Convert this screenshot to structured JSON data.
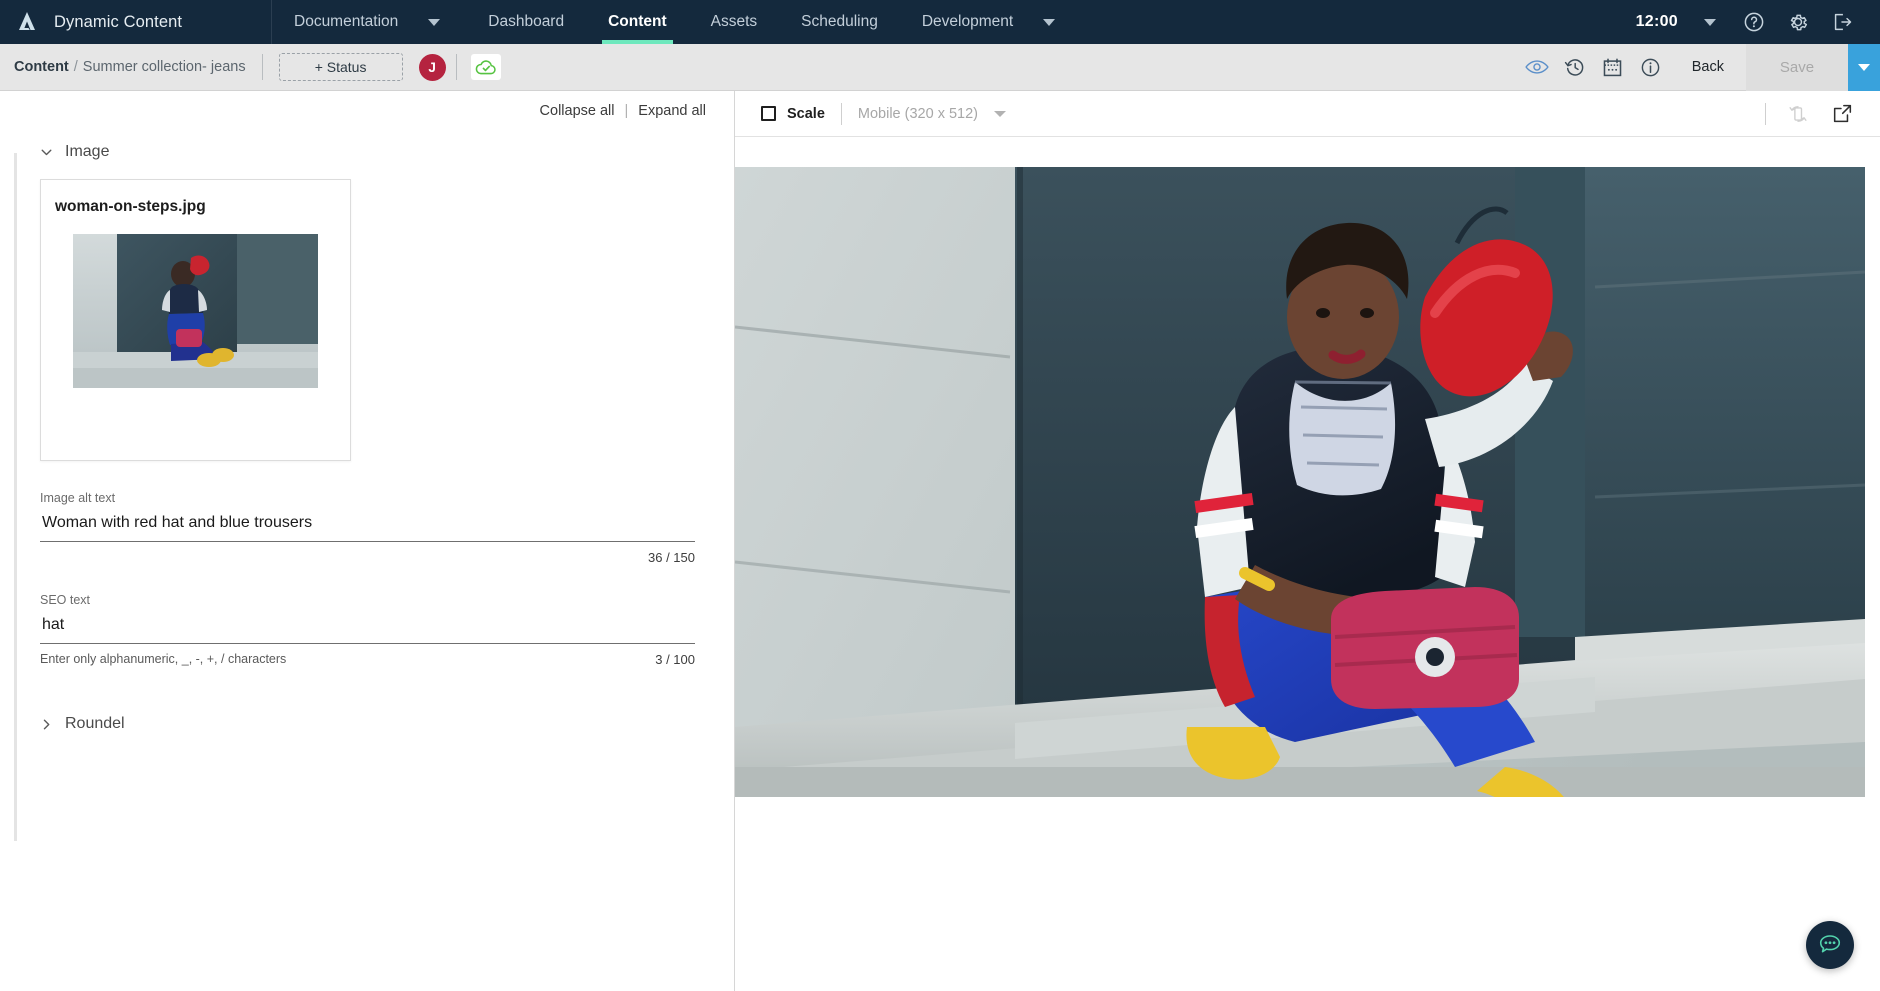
{
  "topnav": {
    "brand": "Dynamic Content",
    "items": [
      {
        "label": "Documentation",
        "active": false,
        "caret": true
      },
      {
        "label": "Dashboard",
        "active": false,
        "caret": false
      },
      {
        "label": "Content",
        "active": true,
        "caret": false
      },
      {
        "label": "Assets",
        "active": false,
        "caret": false
      },
      {
        "label": "Scheduling",
        "active": false,
        "caret": false
      },
      {
        "label": "Development",
        "active": false,
        "caret": true
      }
    ],
    "clock": "12:00",
    "icons": [
      "help-icon",
      "gear-icon",
      "logout-icon"
    ]
  },
  "subbar": {
    "breadcrumb_root": "Content",
    "breadcrumb_sep": "/",
    "breadcrumb_leaf": "Summer collection- jeans",
    "status_button": "+ Status",
    "avatar_initial": "J",
    "cloud_icon": "cloud-check-icon",
    "tool_icons": [
      "preview-eye-icon",
      "version-history-icon",
      "calendar-icon",
      "info-icon"
    ],
    "back_label": "Back",
    "save_label": "Save",
    "save_disabled": true
  },
  "form_panel": {
    "collapse_all": "Collapse all",
    "divider": "|",
    "expand_all": "Expand all",
    "sections": [
      {
        "title": "Image",
        "expanded": true
      },
      {
        "title": "Roundel",
        "expanded": false
      }
    ],
    "asset": {
      "filename": "woman-on-steps.jpg"
    },
    "fields": [
      {
        "label": "Image alt text",
        "value": "Woman with red hat and blue trousers",
        "help": "",
        "count": "36 / 150"
      },
      {
        "label": "SEO text",
        "value": "hat",
        "help": "Enter only alphanumeric, _, -, +, / characters",
        "count": "3 / 100"
      }
    ]
  },
  "preview": {
    "scale_label": "Scale",
    "scale_checked": false,
    "device": "Mobile (320 x 512)",
    "rotate_icon": "rotate-device-icon",
    "open_icon": "open-in-new-icon"
  },
  "chat": {
    "icon": "chat-bubble-icon"
  },
  "colors": {
    "nav_bg": "#14293d",
    "accent_teal": "#6ee8bd",
    "subbar_bg": "#e6e6e6",
    "avatar_red": "#b5233f",
    "save_caret_blue": "#39a2dc",
    "eye_blue": "#5b8fc9"
  }
}
